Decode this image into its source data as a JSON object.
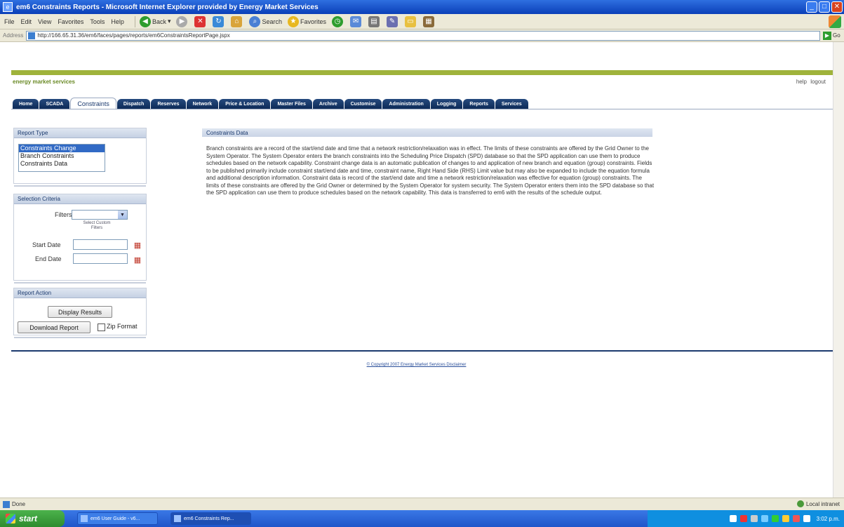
{
  "window": {
    "title": "em6 Constraints Reports - Microsoft Internet Explorer provided by Energy Market Services"
  },
  "menu": [
    "File",
    "Edit",
    "View",
    "Favorites",
    "Tools",
    "Help"
  ],
  "toolbar": {
    "back": "Back",
    "search": "Search",
    "favorites": "Favorites"
  },
  "address": {
    "label": "Address",
    "url": "http://166.65.31.36/em6/faces/pages/reports/em6ConstraintsReportPage.jspx",
    "go": "Go"
  },
  "site": {
    "brand": "energy market services",
    "help": "help",
    "logout": "logout"
  },
  "tabs": [
    "Home",
    "SCADA",
    "Constraints",
    "Dispatch",
    "Reserves",
    "Network",
    "Price & Location",
    "Master Files",
    "Archive",
    "Customise",
    "Administration",
    "Logging",
    "Reports",
    "Services"
  ],
  "active_tab": "Constraints",
  "report_type": {
    "header": "Report Type",
    "options": [
      "Constraints Change",
      "Branch Constraints",
      "Constraints Data"
    ],
    "selected": "Constraints Change"
  },
  "selection": {
    "header": "Selection Criteria",
    "filters_label": "Filters",
    "custom_filters_note": "Select Custom Filters",
    "start_date_label": "Start Date",
    "end_date_label": "End Date"
  },
  "report_action": {
    "header": "Report Action",
    "display_button": "Display Results",
    "download_button": "Download Report",
    "zip_label": "Zip Format"
  },
  "content": {
    "header": "Constraints Data",
    "body": "Branch constraints are a record of the start/end date and time that a network restriction/relaxation was in effect. The limits of these constraints are offered by the Grid Owner to the System Operator. The System Operator enters the branch constraints into the Scheduling Price Dispatch (SPD) database so that the SPD application can use them to produce schedules based on the network capability. Constraint change data is an automatic publication of changes to and application of new branch and equation (group) constraints. Fields to be published primarily include constraint start/end date and time, constraint name, Right Hand Side (RHS) Limit value but may also be expanded to include the equation formula and additional description information. Constraint data is record of the start/end date and time a network restriction/relaxation was effective for equation (group) constraints. The limits of these constraints are offered by the Grid Owner or determined by the System Operator for system security. The System Operator enters them into the SPD database so that the SPD application can use them to produce schedules based on the network capability. This data is transferred to em6 with the results of the schedule output."
  },
  "footer": {
    "copyright": "© Copyright 2007 Energy Market Services Disclaimer"
  },
  "status": {
    "text": "Done",
    "zone": "Local intranet"
  },
  "taskbar": {
    "start": "start",
    "items": [
      "em6 User Guide - v6...",
      "em6 Constraints Rep..."
    ],
    "clock": "3:02 p.m."
  }
}
